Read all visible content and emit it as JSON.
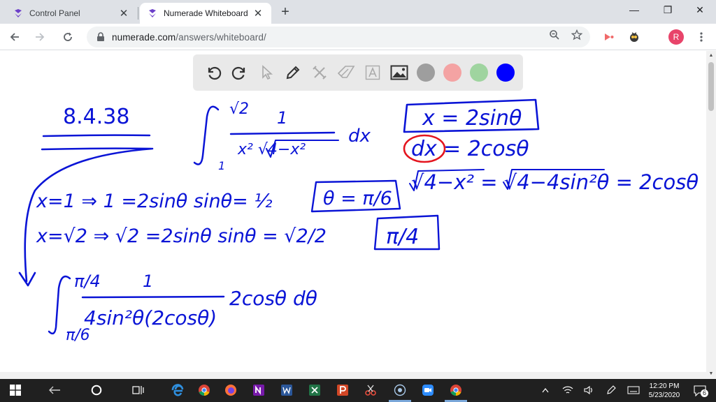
{
  "browser": {
    "tabs": [
      {
        "title": "Control Panel",
        "active": false
      },
      {
        "title": "Numerade Whiteboard",
        "active": true
      }
    ],
    "close_glyph": "✕",
    "new_tab_glyph": "+",
    "window": {
      "minimize": "—",
      "maximize": "❐",
      "close": "✕"
    },
    "address": {
      "host": "numerade.com",
      "path": "/answers/whiteboard/"
    },
    "profile_initial": "R"
  },
  "whiteboard": {
    "toolbar_tools": [
      "undo-icon",
      "redo-icon",
      "select-icon",
      "pen-icon",
      "tools-icon",
      "eraser-icon",
      "text-icon",
      "image-icon"
    ],
    "colors": [
      "#9e9e9e",
      "#f4a3a3",
      "#9fd49f",
      "#0000ff"
    ],
    "ink_color": "#0a14d6",
    "highlight_color": "#e4141e",
    "handwriting": {
      "problem_number": "8.4.38",
      "integral_upper": "√2",
      "integral_lower": "1",
      "integrand_num": "1",
      "integrand_den": "x² √4−x²",
      "dx": "dx",
      "sub_x": "x = 2sinθ",
      "sub_dx_lhs": "dx",
      "sub_dx_rhs": "= 2cosθ",
      "sub_root": "√4−x² = √4−4sin²θ = 2cosθ",
      "line1": "x=1 ⇒ 1 =2sinθ  sinθ= ½",
      "line1_box": "θ = π/6",
      "line2": "x=√2 ⇒ √2 =2sinθ  sinθ = √2/2",
      "line2_box": "π/4",
      "int2_upper": "π/4",
      "int2_lower": "π/6",
      "int2_num": "1",
      "int2_den": "4sin²θ(2cosθ)",
      "int2_tail": "2cosθ dθ"
    }
  },
  "taskbar": {
    "time": "12:20 PM",
    "date": "5/23/2020",
    "notification_count": "6"
  }
}
